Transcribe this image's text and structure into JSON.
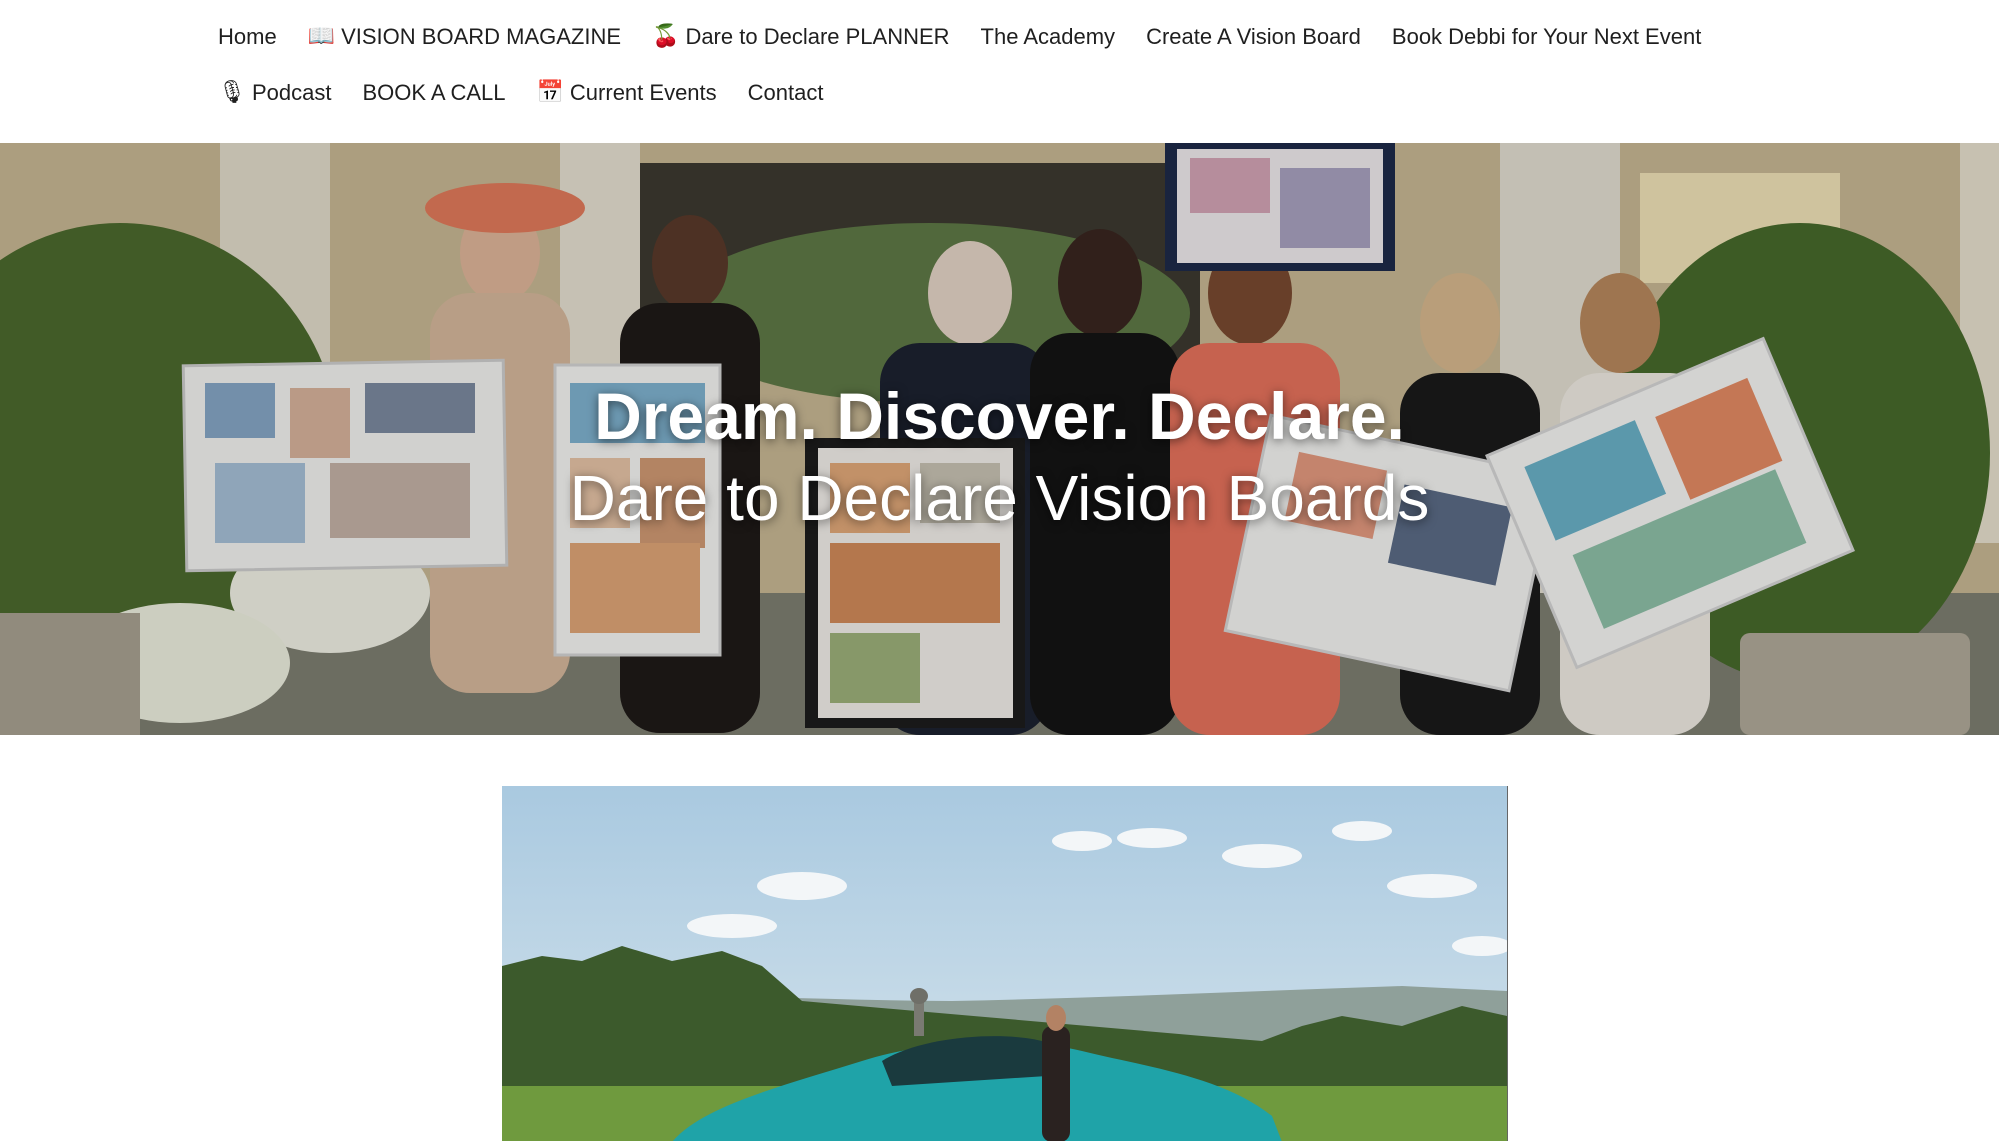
{
  "nav": {
    "items": [
      {
        "icon": "",
        "icon_name": "",
        "label": "Home"
      },
      {
        "icon": "📖",
        "icon_name": "open-book-icon",
        "label": "VISION BOARD MAGAZINE"
      },
      {
        "icon": "🍒",
        "icon_name": "cherries-icon",
        "label": "Dare to Declare PLANNER"
      },
      {
        "icon": "",
        "icon_name": "",
        "label": "The Academy"
      },
      {
        "icon": "",
        "icon_name": "",
        "label": "Create A Vision Board"
      },
      {
        "icon": "",
        "icon_name": "",
        "label": "Book Debbi for Your Next Event"
      },
      {
        "icon": "🎙",
        "icon_name": "microphone-icon",
        "label": "Podcast"
      },
      {
        "icon": "",
        "icon_name": "",
        "label": "BOOK A CALL"
      },
      {
        "icon": "📅",
        "icon_name": "calendar-icon",
        "label": "Current Events"
      },
      {
        "icon": "",
        "icon_name": "",
        "label": "Contact"
      }
    ]
  },
  "hero": {
    "title": "Dream. Discover. Declare.",
    "subtitle": "Dare to Declare Vision Boards",
    "text_color": "#ffffff"
  },
  "feature": {
    "car_color": "#1fa3a8"
  }
}
